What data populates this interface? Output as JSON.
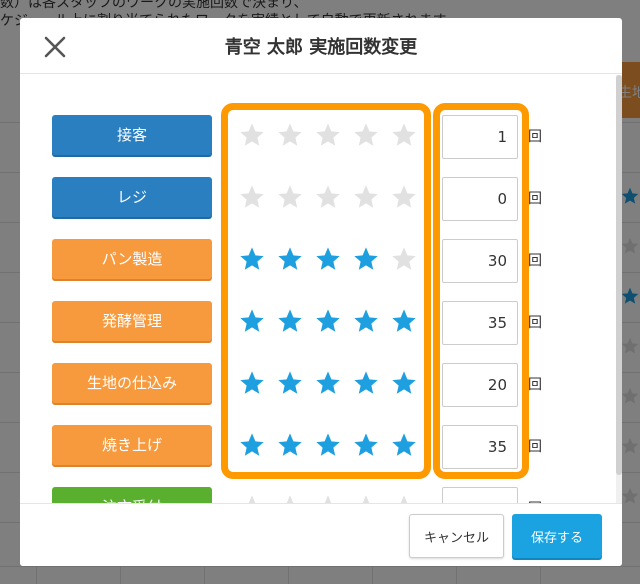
{
  "background": {
    "text_lines": [
      "数）は各スタッフのワークの実施回数で決まり、",
      "ケジュール上に割り当てられたワークを実績として自動で更新されます。"
    ],
    "column_header": "生地"
  },
  "modal": {
    "title": "青空 太郎 実施回数変更",
    "tasks": [
      {
        "label": "接客",
        "color": "blue",
        "rating": 0,
        "count": "1"
      },
      {
        "label": "レジ",
        "color": "blue",
        "rating": 0,
        "count": "0"
      },
      {
        "label": "パン製造",
        "color": "orange",
        "rating": 4,
        "count": "30"
      },
      {
        "label": "発酵管理",
        "color": "orange",
        "rating": 5,
        "count": "35"
      },
      {
        "label": "生地の仕込み",
        "color": "orange",
        "rating": 5,
        "count": "20"
      },
      {
        "label": "焼き上げ",
        "color": "orange",
        "rating": 5,
        "count": "35"
      },
      {
        "label": "注文受付",
        "color": "green",
        "rating": 0,
        "count": ""
      }
    ],
    "unit": "回",
    "max_stars": 5,
    "footer": {
      "cancel_label": "キャンセル",
      "save_label": "保存する"
    }
  },
  "colors": {
    "star_filled": "#1e9fe0",
    "star_empty": "#e1e1e1",
    "highlight": "#ff9900",
    "save_button": "#1aa3e0"
  },
  "icons": {
    "close": "close-icon",
    "star": "star-icon"
  }
}
